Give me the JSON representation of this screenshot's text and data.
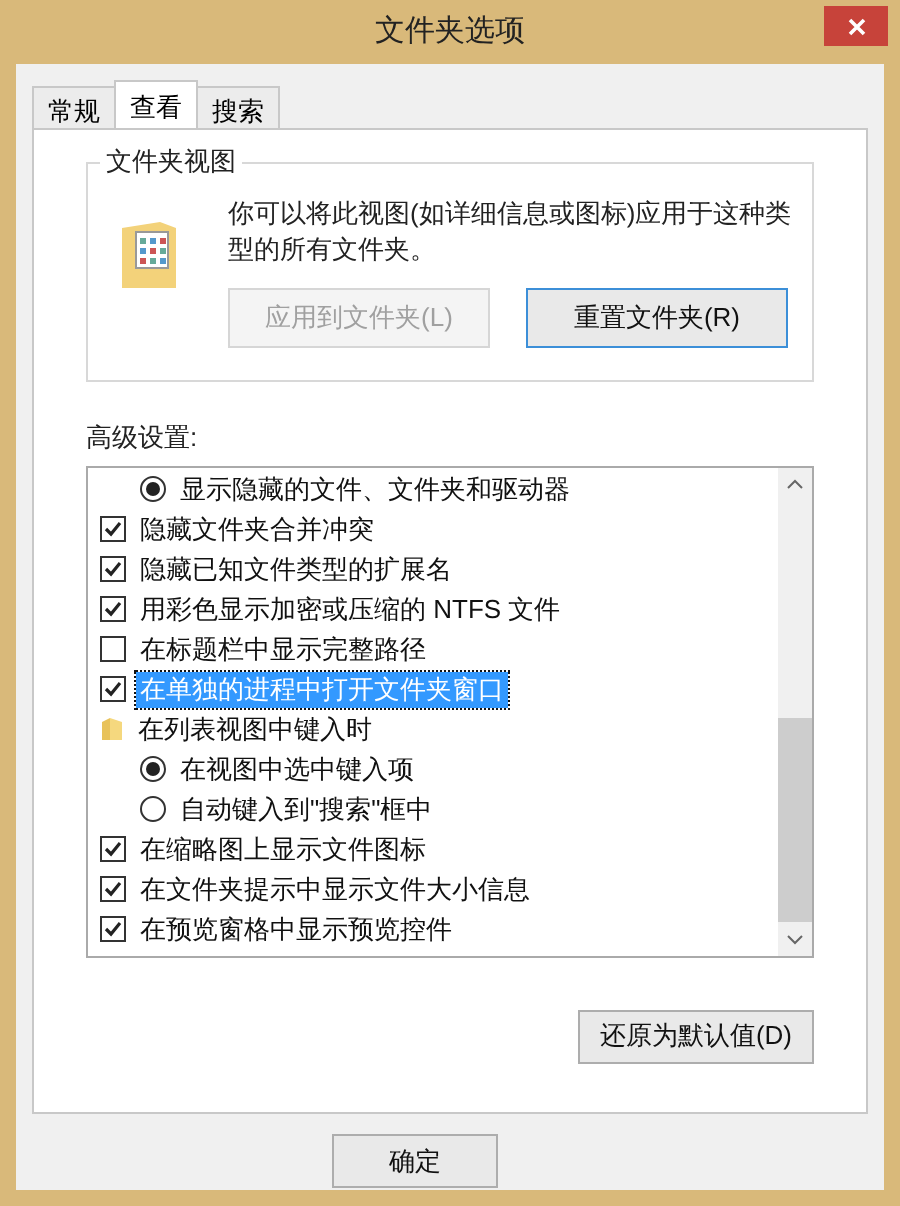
{
  "window": {
    "title": "文件夹选项"
  },
  "tabs": [
    {
      "label": "常规",
      "selected": false
    },
    {
      "label": "查看",
      "selected": true
    },
    {
      "label": "搜索",
      "selected": false
    }
  ],
  "folder_views": {
    "title": "文件夹视图",
    "description": "你可以将此视图(如详细信息或图标)应用于这种类型的所有文件夹。",
    "buttons": [
      {
        "label": "应用到文件夹(L)",
        "disabled": true
      },
      {
        "label": "重置文件夹(R)",
        "disabled": false
      }
    ]
  },
  "advanced": {
    "label": "高级设置:",
    "items": [
      {
        "kind": "radio",
        "label": "显示隐藏的文件、文件夹和驱动器",
        "checked": true,
        "selected": false
      },
      {
        "kind": "checkbox",
        "label": "隐藏文件夹合并冲突",
        "checked": true,
        "selected": false
      },
      {
        "kind": "checkbox",
        "label": "隐藏已知文件类型的扩展名",
        "checked": true,
        "selected": false
      },
      {
        "kind": "checkbox",
        "label": "用彩色显示加密或压缩的 NTFS 文件",
        "checked": true,
        "selected": false
      },
      {
        "kind": "checkbox",
        "label": "在标题栏中显示完整路径",
        "checked": false,
        "selected": false
      },
      {
        "kind": "checkbox",
        "label": "在单独的进程中打开文件夹窗口",
        "checked": true,
        "selected": true
      },
      {
        "kind": "folder",
        "label": "在列表视图中键入时",
        "selected": false,
        "children": [
          {
            "kind": "radio",
            "label": "在视图中选中键入项",
            "checked": true,
            "selected": false
          },
          {
            "kind": "radio",
            "label": "自动键入到\"搜索\"框中",
            "checked": false,
            "selected": false
          }
        ]
      },
      {
        "kind": "checkbox",
        "label": "在缩略图上显示文件图标",
        "checked": true,
        "selected": false
      },
      {
        "kind": "checkbox",
        "label": "在文件夹提示中显示文件大小信息",
        "checked": true,
        "selected": false
      },
      {
        "kind": "checkbox",
        "label": "在预览窗格中显示预览控件",
        "checked": true,
        "selected": false
      }
    ],
    "restore_button": "还原为默认值(D)"
  },
  "buttons": [
    "确定"
  ]
}
